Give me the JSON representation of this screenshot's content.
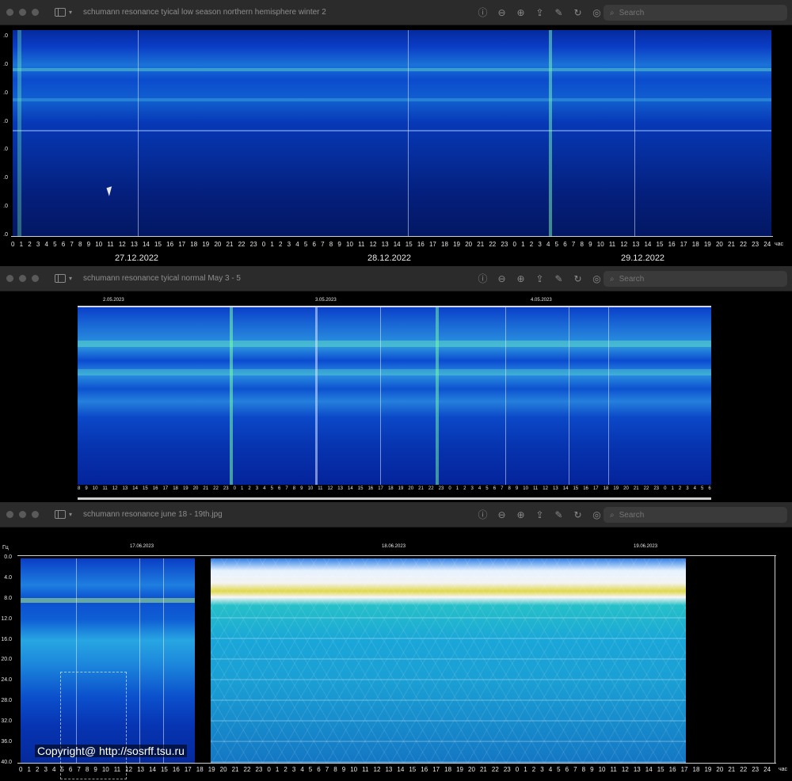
{
  "windows": [
    {
      "title": "schumann resonance tyical low season northern hemisphere winter 2",
      "search_placeholder": "Search",
      "dates": [
        "27.12.2022",
        "28.12.2022",
        "29.12.2022"
      ],
      "hours_axis": [
        "0",
        "1",
        "2",
        "3",
        "4",
        "5",
        "6",
        "7",
        "8",
        "9",
        "10",
        "11",
        "12",
        "13",
        "14",
        "15",
        "16",
        "17",
        "18",
        "19",
        "20",
        "21",
        "22",
        "23",
        "0",
        "1",
        "2",
        "3",
        "4",
        "5",
        "6",
        "7",
        "8",
        "9",
        "10",
        "11",
        "12",
        "13",
        "14",
        "15",
        "16",
        "17",
        "18",
        "19",
        "20",
        "21",
        "22",
        "23",
        "0",
        "1",
        "2",
        "3",
        "4",
        "5",
        "6",
        "7",
        "8",
        "9",
        "10",
        "11",
        "12",
        "13",
        "14",
        "15",
        "16",
        "17",
        "18",
        "19",
        "20",
        "21",
        "22",
        "23",
        "24"
      ],
      "hour_unit": "час"
    },
    {
      "title": "schumann resonance tyical normal May 3 - 5",
      "search_placeholder": "Search",
      "dates": [
        "2.05.2023",
        "3.05.2023",
        "4.05.2023"
      ],
      "hours_axis": [
        "8",
        "9",
        "10",
        "11",
        "12",
        "13",
        "14",
        "15",
        "16",
        "17",
        "18",
        "19",
        "20",
        "21",
        "22",
        "23",
        "0",
        "1",
        "2",
        "3",
        "4",
        "5",
        "6",
        "7",
        "8",
        "9",
        "10",
        "11",
        "12",
        "13",
        "14",
        "15",
        "16",
        "17",
        "18",
        "19",
        "20",
        "21",
        "22",
        "23",
        "0",
        "1",
        "2",
        "3",
        "4",
        "5",
        "6",
        "7",
        "8",
        "9",
        "10",
        "11",
        "12",
        "13",
        "14",
        "15",
        "16",
        "17",
        "18",
        "19",
        "20",
        "21",
        "22",
        "23",
        "0",
        "1",
        "2",
        "3",
        "4",
        "5",
        "6"
      ]
    },
    {
      "title": "schumann resonance june 18 - 19th.jpg",
      "search_placeholder": "Search",
      "dates": [
        "17.06.2023",
        "18.06.2023",
        "19.06.2023"
      ],
      "freq_unit": "Гц",
      "freq_axis": [
        "0.0",
        "4.0",
        "8.0",
        "12.0",
        "16.0",
        "20.0",
        "24.0",
        "28.0",
        "32.0",
        "36.0",
        "40.0"
      ],
      "hours_axis": [
        "0",
        "1",
        "2",
        "3",
        "4",
        "5",
        "6",
        "7",
        "8",
        "9",
        "10",
        "11",
        "12",
        "13",
        "14",
        "15",
        "16",
        "17",
        "18",
        "19",
        "20",
        "21",
        "22",
        "23",
        "0",
        "1",
        "2",
        "3",
        "4",
        "5",
        "6",
        "7",
        "8",
        "9",
        "10",
        "11",
        "12",
        "13",
        "14",
        "15",
        "16",
        "17",
        "18",
        "19",
        "20",
        "21",
        "22",
        "23",
        "0",
        "1",
        "2",
        "3",
        "4",
        "5",
        "6",
        "7",
        "8",
        "9",
        "10",
        "11",
        "12",
        "13",
        "14",
        "15",
        "16",
        "17",
        "18",
        "19",
        "20",
        "21",
        "22",
        "23",
        "24"
      ],
      "hour_unit": "час",
      "copyright": "Copyright@ http://sosrff.tsu.ru"
    }
  ],
  "toolbar_icons": [
    "info-icon",
    "zoom-out-icon",
    "zoom-in-icon",
    "share-icon",
    "markup-icon",
    "rotate-icon",
    "search-icon"
  ],
  "colors": {
    "titlebar": "#2b2b2b",
    "spectrogram_blue": "#0b4bcd",
    "resonance_cyan": "#26c0c8"
  }
}
